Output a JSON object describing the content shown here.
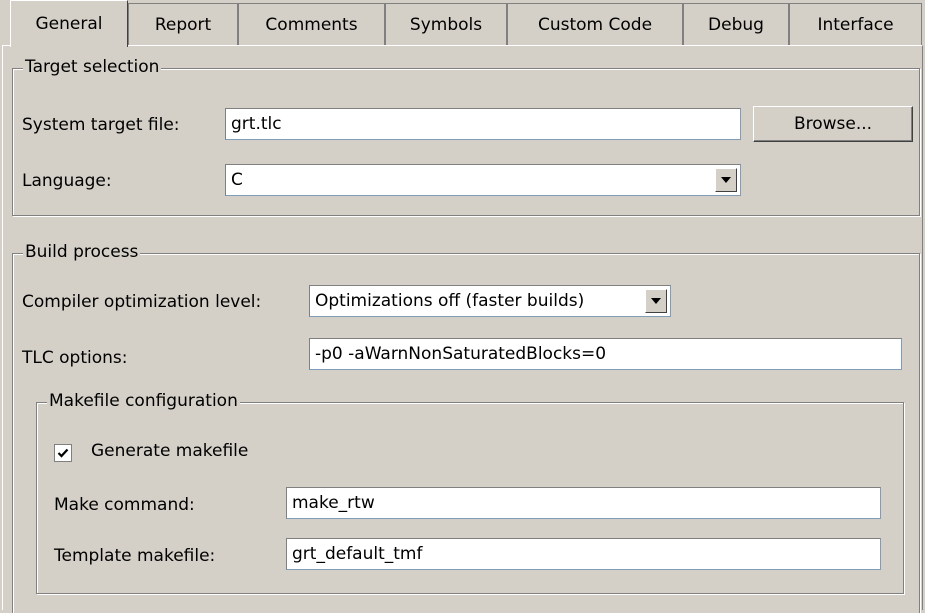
{
  "tabs": [
    "General",
    "Report",
    "Comments",
    "Symbols",
    "Custom Code",
    "Debug",
    "Interface"
  ],
  "target_selection": {
    "legend": "Target selection",
    "system_target_file_label": "System target file:",
    "system_target_file_value": "grt.tlc",
    "browse_label": "Browse...",
    "language_label": "Language:",
    "language_value": "C"
  },
  "build_process": {
    "legend": "Build process",
    "compiler_opt_label": "Compiler optimization level:",
    "compiler_opt_value": "Optimizations off (faster builds)",
    "tlc_options_label": "TLC options:",
    "tlc_options_value": "-p0 -aWarnNonSaturatedBlocks=0",
    "makefile": {
      "legend": "Makefile configuration",
      "generate_makefile_label": "Generate makefile",
      "generate_makefile_checked": true,
      "make_command_label": "Make command:",
      "make_command_value": "make_rtw",
      "template_makefile_label": "Template makefile:",
      "template_makefile_value": "grt_default_tmf"
    }
  }
}
